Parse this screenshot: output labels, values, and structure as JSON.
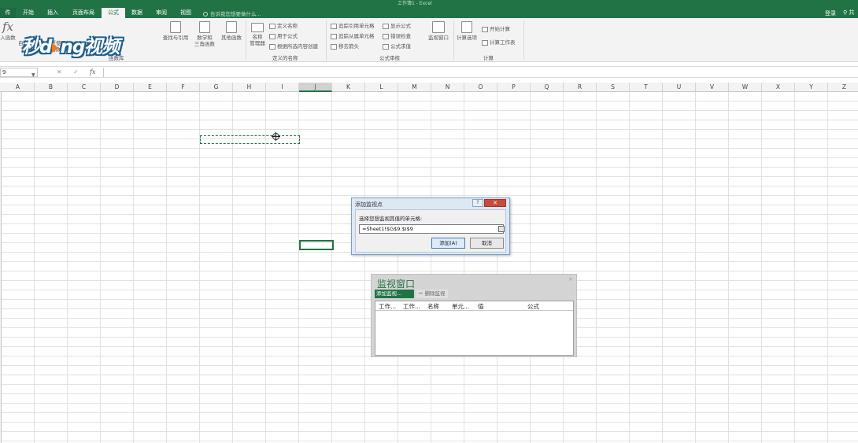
{
  "app": {
    "doc_title": "工作簿1 - Excel"
  },
  "tabs": {
    "file": "件",
    "items": [
      {
        "label": "开始"
      },
      {
        "label": "插入"
      },
      {
        "label": "页面布局"
      },
      {
        "label": "公式",
        "active": true
      },
      {
        "label": "数据"
      },
      {
        "label": "审阅"
      },
      {
        "label": "视图"
      }
    ],
    "tell_me": "告诉我您想要做什么...",
    "login": "登录",
    "share": "共"
  },
  "watermark": {
    "part1": "秒d",
    "part2": "ng视频"
  },
  "ribbon": {
    "insert_function": "入函数",
    "autosum": "自动求和",
    "recent": "最近使用的",
    "recent2": "函数",
    "lookup": "查找与引用",
    "math1": "数学和",
    "math2": "三角函数",
    "other": "其他函数",
    "group_function_library": "函数库",
    "name_manager1": "名称",
    "name_manager2": "管理器",
    "define_name": "定义名称",
    "use_in_formula": "用于公式",
    "create_from_selection": "根据所选内容创建",
    "group_defined_names": "定义的名称",
    "trace_precedents": "追踪引用单元格",
    "trace_dependents": "追踪从属单元格",
    "remove_arrows": "移去箭头",
    "show_formulas": "显示公式",
    "error_checking": "错误检查",
    "evaluate_formula": "公式求值",
    "group_formula_auditing": "公式审核",
    "watch_window": "监视窗口",
    "calc_options": "计算选项",
    "calc_now": "开始计算",
    "calc_sheet": "计算工作表",
    "group_calculation": "计算"
  },
  "formula_bar": {
    "name_box": "9",
    "cancel": "✕",
    "enter": "✓",
    "fx": "fx",
    "value": ""
  },
  "columns": [
    "A",
    "B",
    "C",
    "D",
    "E",
    "F",
    "G",
    "H",
    "I",
    "J",
    "K",
    "L",
    "M",
    "N",
    "O",
    "P",
    "Q",
    "R",
    "S",
    "T",
    "U",
    "V",
    "W",
    "X",
    "Y",
    "Z"
  ],
  "selected_column": "J",
  "add_watch_dialog": {
    "title": "添加监视点",
    "help": "?",
    "close": "✕",
    "prompt": "选择您想监视其值的单元格:",
    "input_value": "=Sheet1!$G$9:$I$9",
    "add_button": "添加(A)",
    "cancel_button": "取消"
  },
  "watch_window": {
    "title": "监视窗口",
    "close": "×",
    "add_watch": "添加监视...",
    "delete_watch": "删除监视",
    "columns": [
      "工作...",
      "工作...",
      "名称",
      "单元...",
      "值",
      "公式"
    ]
  }
}
